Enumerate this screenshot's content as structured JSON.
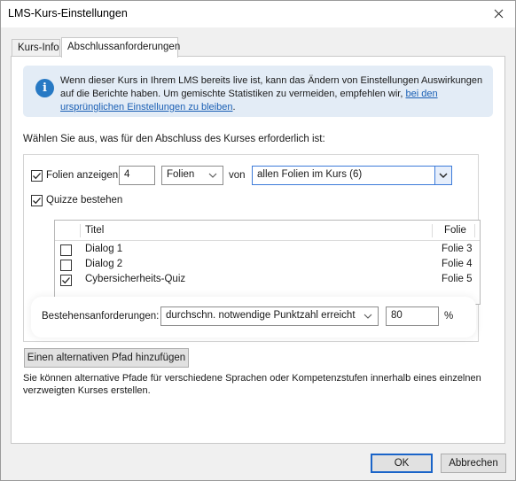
{
  "window": {
    "title": "LMS-Kurs-Einstellungen"
  },
  "tabs": [
    {
      "label": "Kurs-Info",
      "active": false
    },
    {
      "label": "Abschlussanforderungen",
      "active": true
    }
  ],
  "info": {
    "text": "Wenn dieser Kurs in Ihrem LMS bereits live ist, kann das Ändern von Einstellungen Auswirkungen auf die Berichte haben. Um gemischte Statistiken zu vermeiden, empfehlen wir,",
    "link": "bei den ursprünglichen Einstellungen zu bleiben",
    "suffix": "."
  },
  "instruction": "Wählen Sie aus, was für den Abschluss des Kurses erforderlich ist:",
  "slides_option": {
    "label": "Folien anzeigen",
    "checked": true,
    "count_value": "4",
    "unit_value": "Folien",
    "connector": "von",
    "scope_value": "allen Folien im Kurs (6)"
  },
  "quiz_option": {
    "label": "Quizze bestehen",
    "checked": true
  },
  "quiz_table": {
    "columns": [
      "Titel",
      "Folie"
    ],
    "rows": [
      {
        "title": "Dialog 1",
        "slide": "Folie 3",
        "checked": false
      },
      {
        "title": "Dialog 2",
        "slide": "Folie 4",
        "checked": false
      },
      {
        "title": "Cybersicherheits-Quiz",
        "slide": "Folie 5",
        "checked": true
      }
    ]
  },
  "pass_requirements": {
    "label": "Bestehensanforderungen:",
    "value": "durchschn. notwendige Punktzahl erreicht",
    "score": "80",
    "unit": "%"
  },
  "alt_path": {
    "button_label": "Einen alternativen Pfad hinzufügen",
    "hint": "Sie können alternative Pfade für verschiedene Sprachen oder Kompetenzstufen innerhalb eines einzelnen verzweigten Kurses erstellen."
  },
  "footer": {
    "ok_label": "OK",
    "cancel_label": "Abbrechen"
  },
  "colors": {
    "info_bg": "#e3ecf6",
    "accent": "#2779c4",
    "link": "#1a5fb4"
  }
}
